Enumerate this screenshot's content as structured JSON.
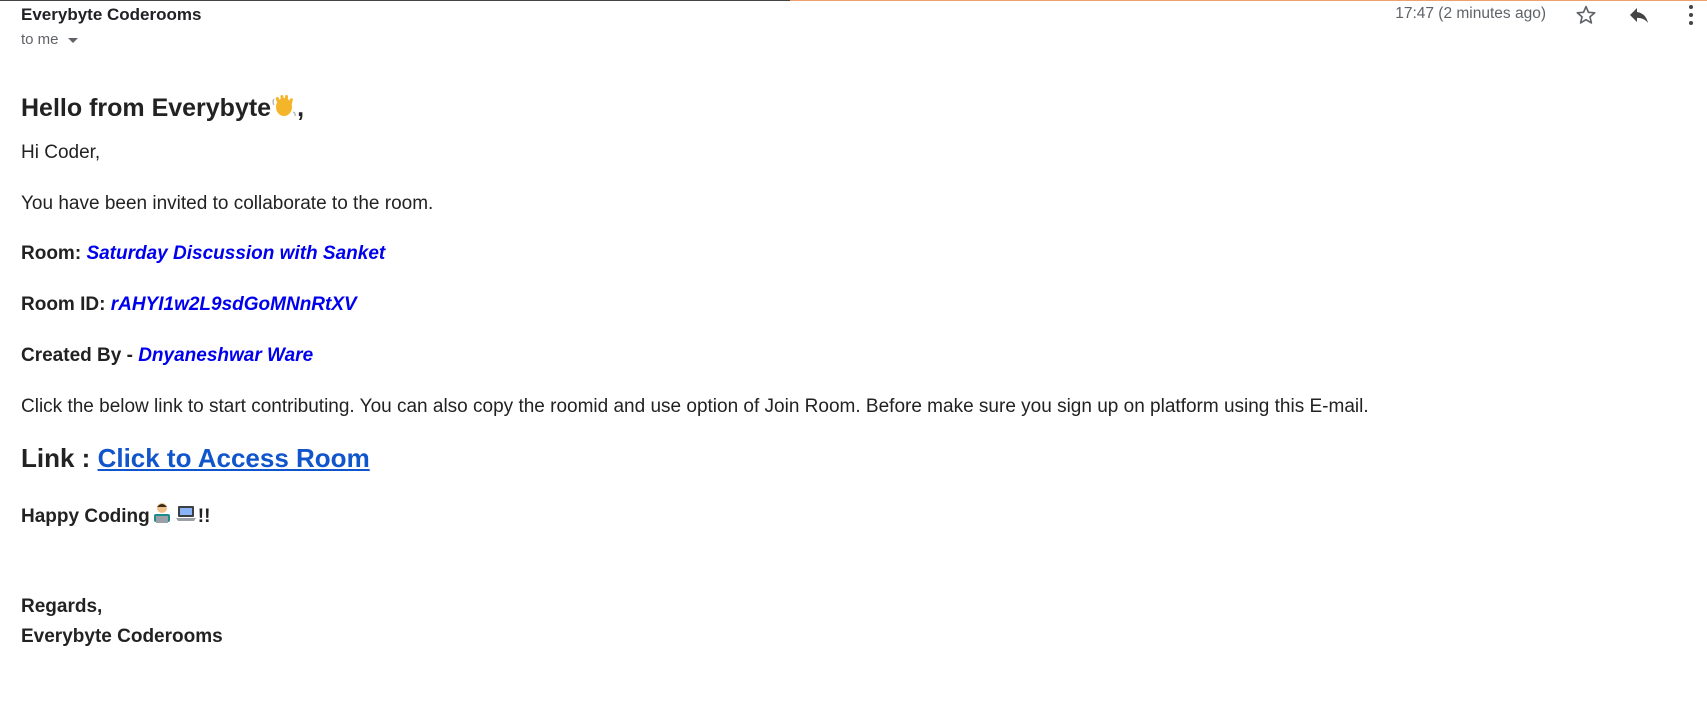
{
  "header": {
    "sender": "Everybyte Coderooms",
    "recipient_label": "to me",
    "timestamp": "17:47 (2 minutes ago)",
    "icons": [
      "star-icon",
      "reply-icon",
      "more-vert-icon",
      "chevron-down-icon"
    ]
  },
  "email": {
    "greeting": "Hello from Everybyte",
    "greeting_suffix": ",",
    "salutation": "Hi Coder,",
    "invite_text": "You have been invited to collaborate to the room.",
    "room_label": "Room: ",
    "room_name": "Saturday Discussion with Sanket",
    "room_id_label": "Room ID: ",
    "room_id": "rAHYI1w2L9sdGoMNnRtXV",
    "created_by_label": "Created By - ",
    "created_by": "Dnyaneshwar Ware",
    "instructions": "Click the below link to start contributing. You can also copy the roomid and use option of Join Room. Before make sure you sign up on platform using this E-mail.",
    "link_label": "Link : ",
    "link_text": "Click to Access Room",
    "happy_text": "Happy Coding",
    "happy_suffix": "!!",
    "regards": "Regards,",
    "signature": "Everybyte Coderooms"
  },
  "colors": {
    "room_accent": "#0000ee",
    "link": "#1155cc",
    "meta_gray": "#5f6368"
  }
}
